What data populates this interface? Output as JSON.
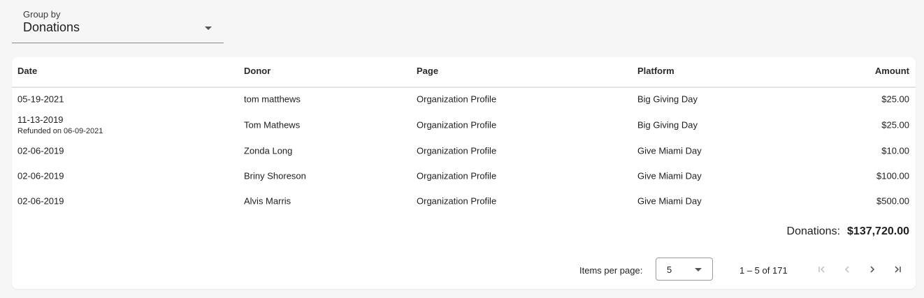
{
  "group_by": {
    "label": "Group by",
    "value": "Donations"
  },
  "table": {
    "columns": [
      "Date",
      "Donor",
      "Page",
      "Platform",
      "Amount"
    ],
    "rows": [
      {
        "date": "05-19-2021",
        "note": "",
        "donor": "tom matthews",
        "page": "Organization Profile",
        "platform": "Big Giving Day",
        "amount": "$25.00"
      },
      {
        "date": "11-13-2019",
        "note": "Refunded on 06-09-2021",
        "donor": "Tom Mathews",
        "page": "Organization Profile",
        "platform": "Big Giving Day",
        "amount": "$25.00"
      },
      {
        "date": "02-06-2019",
        "note": "",
        "donor": "Zonda Long",
        "page": "Organization Profile",
        "platform": "Give Miami Day",
        "amount": "$10.00"
      },
      {
        "date": "02-06-2019",
        "note": "",
        "donor": "Briny Shoreson",
        "page": "Organization Profile",
        "platform": "Give Miami Day",
        "amount": "$100.00"
      },
      {
        "date": "02-06-2019",
        "note": "",
        "donor": "Alvis Marris",
        "page": "Organization Profile",
        "platform": "Give Miami Day",
        "amount": "$500.00"
      }
    ]
  },
  "total": {
    "label": "Donations:",
    "value": "$137,720.00"
  },
  "paginator": {
    "items_per_page_label": "Items per page:",
    "page_size": "5",
    "range": "1 – 5 of 171"
  },
  "colors": {
    "disabled_icon": "#c4c4c4",
    "enabled_icon": "#5a5a5a"
  }
}
